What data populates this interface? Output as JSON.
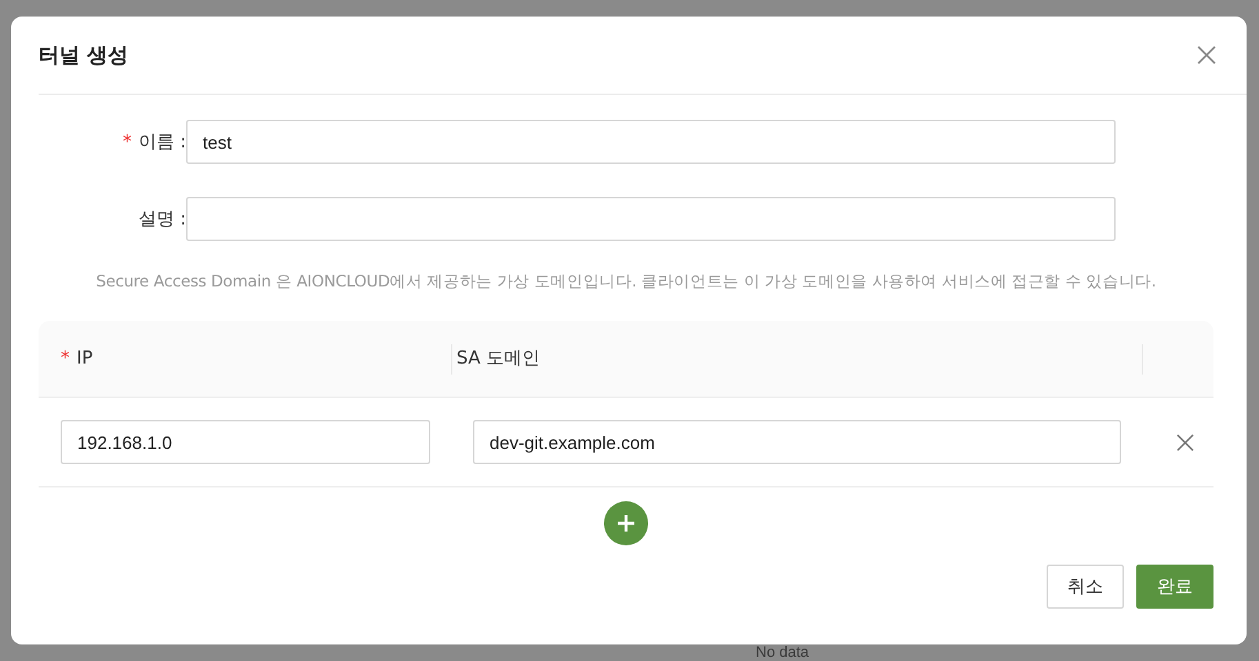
{
  "background": {
    "empty_text": "No data"
  },
  "dialog": {
    "title": "터널 생성",
    "fields": [
      {
        "label": "이름 :",
        "required_mark": "*",
        "value": "test"
      },
      {
        "label": "설명 :"
      }
    ],
    "hint": "Secure Access Domain 은 AIONCLOUD에서 제공하는 가상 도메인입니다. 클라이언트는 이 가상 도메인을 사용하여 서비스에 접근할 수 있습니다.",
    "table": {
      "columns": [
        {
          "label": "IP",
          "required_mark": "*"
        },
        {
          "label": "SA 도메인"
        }
      ],
      "rows": [
        {
          "ip": "192.168.1.0",
          "domain": "dev-git.example.com"
        }
      ]
    },
    "buttons": [
      {
        "label": "취소",
        "kind": "default"
      },
      {
        "label": "완료",
        "kind": "primary"
      }
    ]
  }
}
